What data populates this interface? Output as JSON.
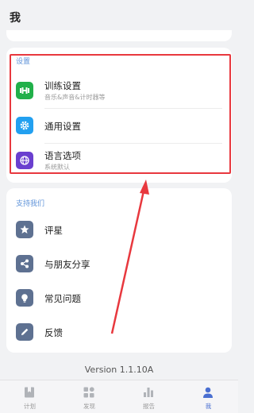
{
  "header": {
    "title": "我"
  },
  "settings_section": {
    "title": "设置",
    "items": [
      {
        "icon": "dumbbell-icon",
        "color": "#21b04a",
        "label": "训练设置",
        "sub": "音乐&声音&计时器等"
      },
      {
        "icon": "gear-icon",
        "color": "#22a0f0",
        "label": "通用设置",
        "sub": ""
      },
      {
        "icon": "globe-icon",
        "color": "#6a3fcf",
        "label": "语言选项",
        "sub": "系统默认"
      }
    ]
  },
  "support_section": {
    "title": "支持我们",
    "items": [
      {
        "icon": "star-icon",
        "color": "#5e7191",
        "label": "评星"
      },
      {
        "icon": "share-icon",
        "color": "#5e7191",
        "label": "与朋友分享"
      },
      {
        "icon": "lightbulb-icon",
        "color": "#5e7191",
        "label": "常见问题"
      },
      {
        "icon": "pencil-icon",
        "color": "#5e7191",
        "label": "反馈"
      }
    ]
  },
  "version": "Version 1.1.10A",
  "tabs": [
    {
      "label": "计划",
      "icon": "bookmark-icon",
      "active": false
    },
    {
      "label": "发现",
      "icon": "grid-icon",
      "active": false
    },
    {
      "label": "报告",
      "icon": "bar-chart-icon",
      "active": false
    },
    {
      "label": "我",
      "icon": "person-icon",
      "active": true
    }
  ],
  "colors": {
    "accent": "#4a6fd1",
    "highlight": "#e8383e",
    "section_title": "#5f93d9"
  }
}
